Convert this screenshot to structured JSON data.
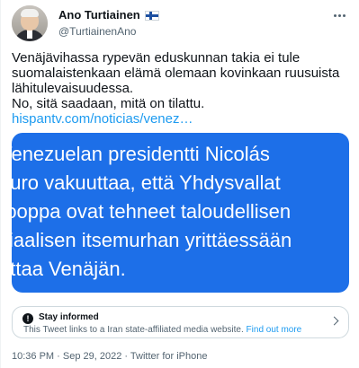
{
  "author": {
    "display_name": "Ano Turtiainen",
    "handle": "@TurtiainenAno",
    "flag": "finland-flag"
  },
  "tweet": {
    "text_line_1": "Venäjävihassa rypevän eduskunnan takia ei tule suomalaistenkaan elämä olemaan kovinkaan ruusuista lähitulevaisuudessa.",
    "text_line_2": "No, sitä saadaan, mitä on tilattu.",
    "link": "hispantv.com/noticias/venez…"
  },
  "media": {
    "lines": [
      "Venezuelan presidentti Nicolás",
      "duro vakuuttaa, että Yhdysvallat",
      "rooppa ovat tehneet taloudellisen",
      "siaalisen itsemurhan yrittäessään",
      "ettaa Venäjän."
    ],
    "background": "#1d6fe8"
  },
  "notice": {
    "title": "Stay informed",
    "description": "This Tweet links to a Iran state-affiliated media website.",
    "action": "Find out more"
  },
  "meta": {
    "timestamp": "10:36 PM · Sep 29, 2022 · Twitter for iPhone"
  },
  "colors": {
    "accent": "#1d9bf0",
    "text": "#0f1419",
    "secondary": "#536471"
  }
}
